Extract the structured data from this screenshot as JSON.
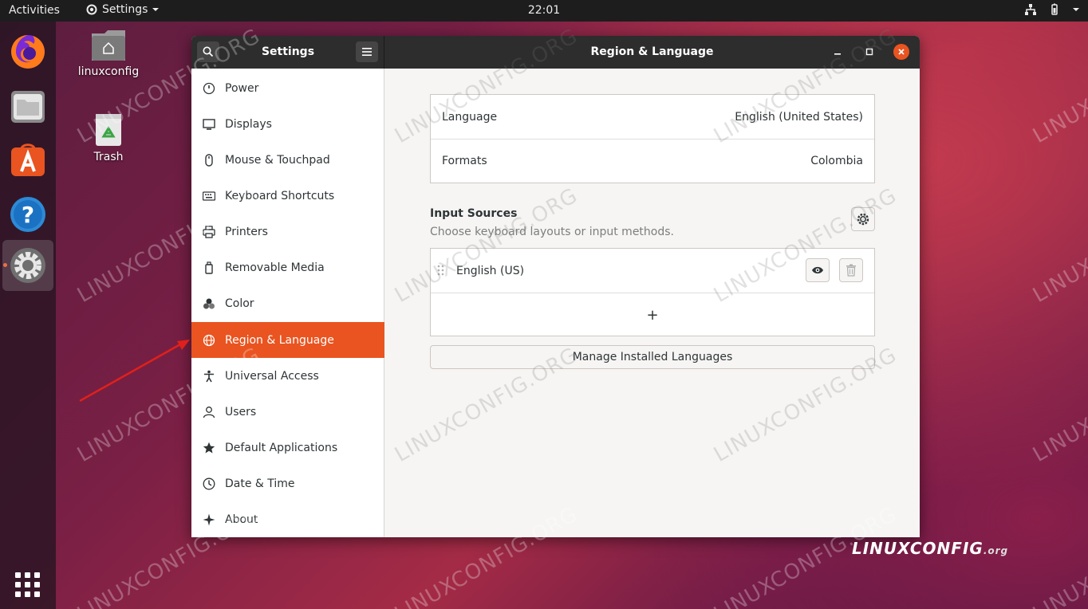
{
  "topbar": {
    "activities": "Activities",
    "app_menu": "Settings",
    "clock": "22:01"
  },
  "desktop": {
    "home_label": "linuxconfig",
    "trash_label": "Trash"
  },
  "window": {
    "sidebar_title": "Settings",
    "title": "Region & Language"
  },
  "sidebar": {
    "items": [
      {
        "label": "Power",
        "icon": "power-icon"
      },
      {
        "label": "Displays",
        "icon": "display-icon"
      },
      {
        "label": "Mouse & Touchpad",
        "icon": "mouse-icon"
      },
      {
        "label": "Keyboard Shortcuts",
        "icon": "keyboard-icon"
      },
      {
        "label": "Printers",
        "icon": "printer-icon"
      },
      {
        "label": "Removable Media",
        "icon": "media-icon"
      },
      {
        "label": "Color",
        "icon": "color-icon"
      },
      {
        "label": "Region & Language",
        "icon": "globe-icon",
        "selected": true
      },
      {
        "label": "Universal Access",
        "icon": "accessibility-icon"
      },
      {
        "label": "Users",
        "icon": "user-icon"
      },
      {
        "label": "Default Applications",
        "icon": "star-icon"
      },
      {
        "label": "Date & Time",
        "icon": "clock-icon"
      },
      {
        "label": "About",
        "icon": "sparkle-icon"
      }
    ]
  },
  "region": {
    "language_label": "Language",
    "language_value": "English (United States)",
    "formats_label": "Formats",
    "formats_value": "Colombia",
    "input_sources_title": "Input Sources",
    "input_sources_sub": "Choose keyboard layouts or input methods.",
    "input_source": "English (US)",
    "add_symbol": "+",
    "manage_button": "Manage Installed Languages"
  },
  "watermark": {
    "text": "LINUXCONFIG.ORG",
    "brand": "LINUXCONFIG",
    "brand_suffix": ".org"
  },
  "colors": {
    "accent": "#e95420",
    "headerbar": "#2d2d2d",
    "topbar": "#1d1d1d"
  }
}
